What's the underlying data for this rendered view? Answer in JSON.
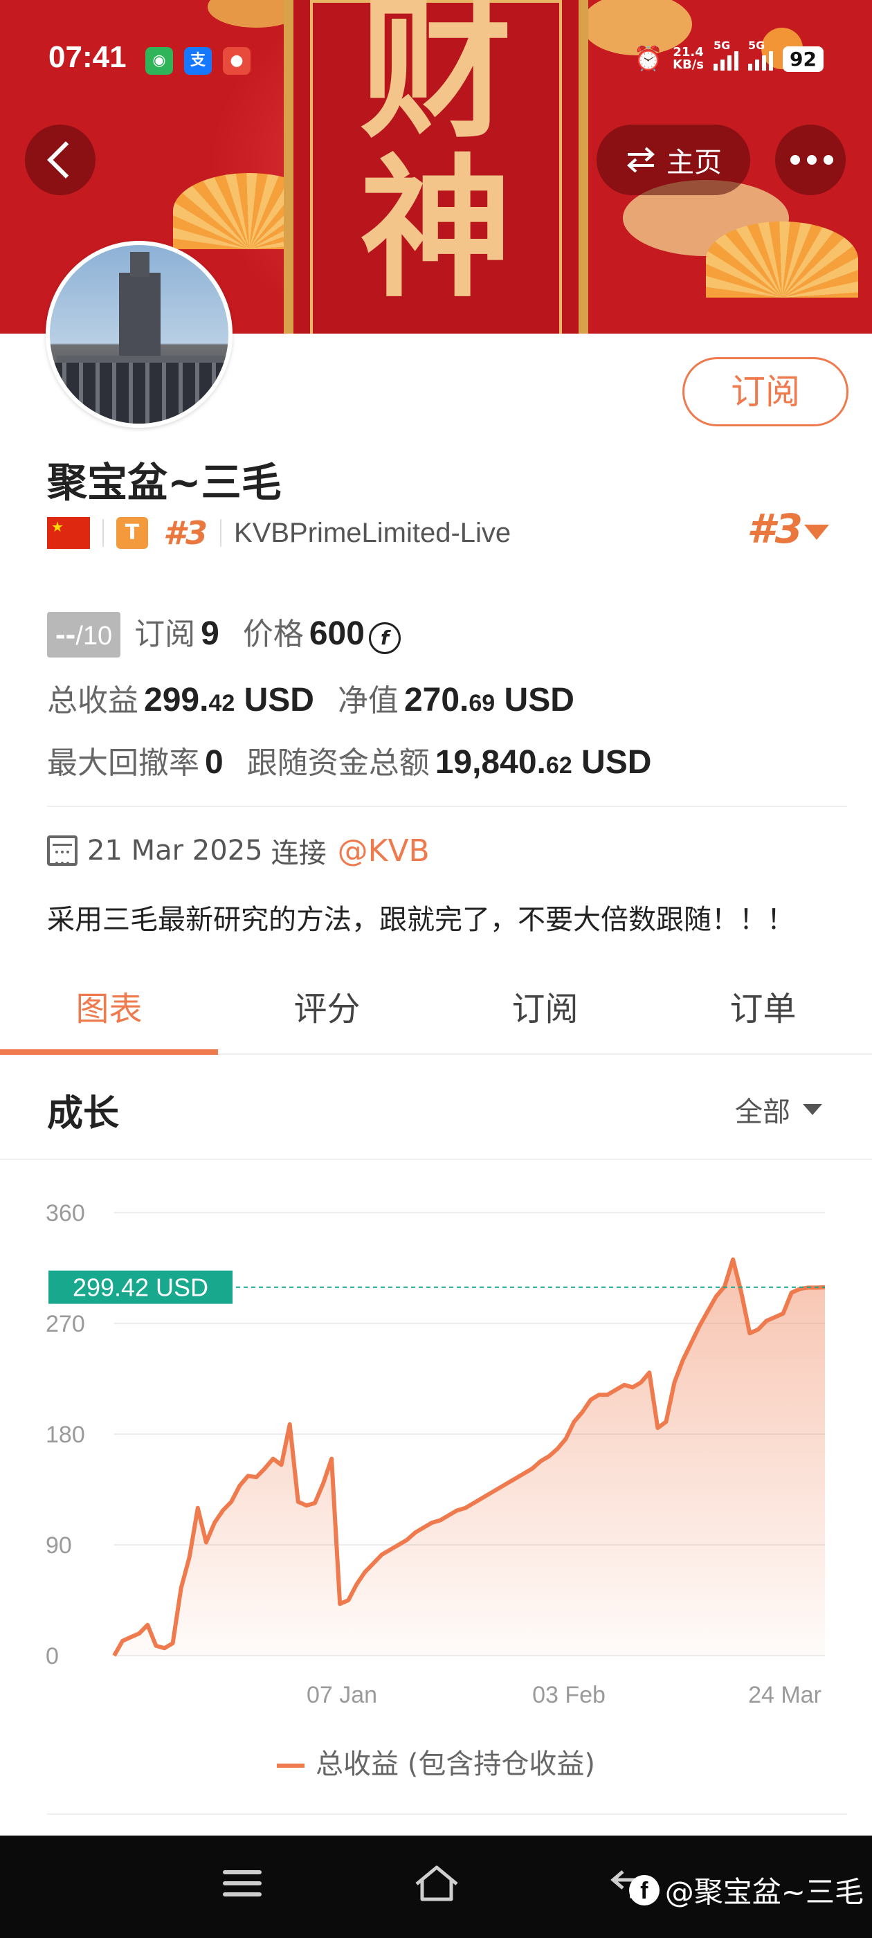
{
  "status_bar": {
    "time": "07:41",
    "speed_value": "21.4",
    "speed_unit": "KB/s",
    "sim1_label": "5G",
    "sim2_label": "5G",
    "battery": "92"
  },
  "banner": {
    "char_top": "财",
    "char_bottom": "神",
    "home_label": "主页"
  },
  "profile": {
    "subscribe_label": "订阅",
    "name": "聚宝盆~三毛",
    "tier_badge": "T",
    "rank": "#3",
    "broker": "KVBPrimeLimited-Live",
    "rank_right": "#3"
  },
  "stats": {
    "score_value": "--",
    "score_max": "/10",
    "subscribe_label": "订阅",
    "subscribe_count": "9",
    "price_label": "价格",
    "price_value": "600",
    "total_profit_label": "总收益",
    "total_profit_int": "299.",
    "total_profit_dec": "42",
    "total_profit_unit": "USD",
    "net_value_label": "净值",
    "net_value_int": "270.",
    "net_value_dec": "69",
    "net_value_unit": "USD",
    "max_drawdown_label": "最大回撤率",
    "max_drawdown_value": "0",
    "follow_funds_label": "跟随资金总额",
    "follow_funds_int": "19,840.",
    "follow_funds_dec": "62",
    "follow_funds_unit": "USD"
  },
  "info": {
    "date": "21 Mar 2025",
    "connect_label": "连接",
    "provider": "@KVB",
    "description": "采用三毛最新研究的方法，跟就完了，不要大倍数跟随！！！"
  },
  "tabs": [
    "图表",
    "评分",
    "订阅",
    "订单"
  ],
  "growth": {
    "title": "成长",
    "range_label": "全部"
  },
  "chart_data": {
    "type": "area",
    "ylim": [
      0,
      360
    ],
    "yticks": [
      0,
      90,
      180,
      270,
      360
    ],
    "ytick_labels": [
      "0",
      "90",
      "180",
      "270",
      "360"
    ],
    "xtick_labels": [
      "07 Jan",
      "03 Feb",
      "24 Mar"
    ],
    "current_value_label": "299.42 USD",
    "current_value": 299.42,
    "legend": "总收益 (包含持仓收益)",
    "line_color": "#ee7a4d",
    "label_color": "#17a88e",
    "x": [
      0,
      2,
      4,
      6,
      8,
      10,
      12,
      14,
      16,
      18,
      20,
      22,
      24,
      26,
      28,
      30,
      32,
      34,
      36,
      38,
      40,
      42,
      44,
      46,
      48,
      50,
      52,
      54,
      56,
      58,
      60,
      62,
      64,
      66,
      68,
      70,
      72,
      74,
      76,
      78,
      80,
      82,
      84,
      86,
      88,
      90,
      92,
      94,
      96,
      98,
      100,
      102,
      104,
      106,
      108,
      110,
      112,
      114,
      116,
      118,
      120,
      122,
      124,
      126,
      128,
      130,
      132,
      134,
      136,
      138,
      140,
      142,
      144,
      146,
      148,
      150,
      152,
      154,
      156,
      158,
      160,
      162,
      164,
      166,
      168,
      170
    ],
    "values": [
      0,
      12,
      15,
      18,
      25,
      8,
      6,
      10,
      55,
      80,
      120,
      92,
      108,
      118,
      125,
      138,
      146,
      145,
      152,
      160,
      155,
      188,
      125,
      122,
      124,
      140,
      160,
      42,
      45,
      58,
      68,
      75,
      82,
      86,
      90,
      94,
      100,
      104,
      108,
      110,
      114,
      118,
      120,
      124,
      128,
      132,
      136,
      140,
      144,
      148,
      152,
      158,
      162,
      168,
      176,
      190,
      198,
      208,
      212,
      212,
      216,
      220,
      218,
      222,
      230,
      185,
      190,
      222,
      240,
      254,
      268,
      280,
      292,
      300,
      322,
      295,
      262,
      265,
      272,
      275,
      278,
      295,
      298,
      299,
      299,
      299.42
    ]
  },
  "nav": {
    "watermark": "@聚宝盆~三毛"
  }
}
